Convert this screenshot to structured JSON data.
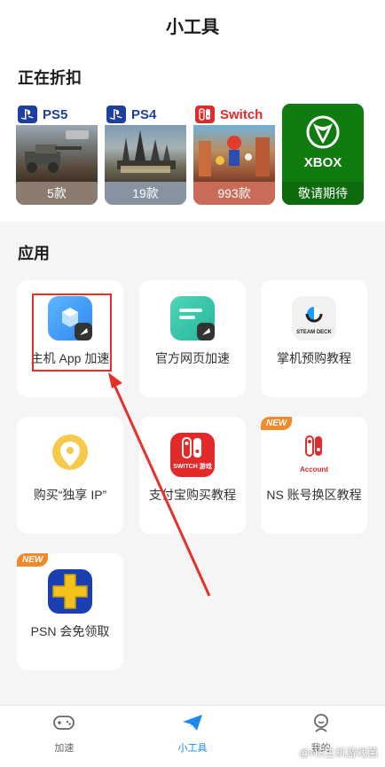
{
  "header": {
    "title": "小工具"
  },
  "deals": {
    "title": "正在折扣",
    "items": [
      {
        "platform": "PS5",
        "count": "5款",
        "accent": "#1e3fa0"
      },
      {
        "platform": "PS4",
        "count": "19款",
        "accent": "#1e3fa0"
      },
      {
        "platform": "Switch",
        "count": "993款",
        "accent": "#e4292b"
      },
      {
        "platform": "XBOX",
        "count": "敬请期待",
        "accent": "#107c10"
      }
    ]
  },
  "apps": {
    "title": "应用",
    "items": [
      {
        "label": "主机 App 加速",
        "icon": "box-rocket-icon",
        "new": false
      },
      {
        "label": "官方网页加速",
        "icon": "web-rocket-icon",
        "new": false
      },
      {
        "label": "掌机预购教程",
        "icon": "steam-deck-icon",
        "icon_text": "STEAM DECK",
        "new": false
      },
      {
        "label": "购买“独享 IP”",
        "icon": "location-pin-icon",
        "new": false
      },
      {
        "label": "支付宝购买教程",
        "icon": "switch-logo-icon",
        "icon_text": "SWITCH 游戏",
        "new": false
      },
      {
        "label": "NS 账号换区教程",
        "icon": "nintendo-account-icon",
        "icon_text": "Account",
        "new": true
      },
      {
        "label": "PSN 会免领取",
        "icon": "ps-plus-icon",
        "new": true
      }
    ],
    "new_badge": "NEW"
  },
  "tabbar": {
    "tabs": [
      {
        "label": "加速",
        "icon": "gamepad-icon"
      },
      {
        "label": "小工具",
        "icon": "paper-plane-icon",
        "active": true
      },
      {
        "label": "我的",
        "icon": "profile-icon"
      }
    ]
  },
  "watermark": "@NS主机游戏菌",
  "colors": {
    "accent_blue": "#1c8cf0",
    "highlight_red": "#e5312a",
    "new_orange": "#f28a2a"
  }
}
